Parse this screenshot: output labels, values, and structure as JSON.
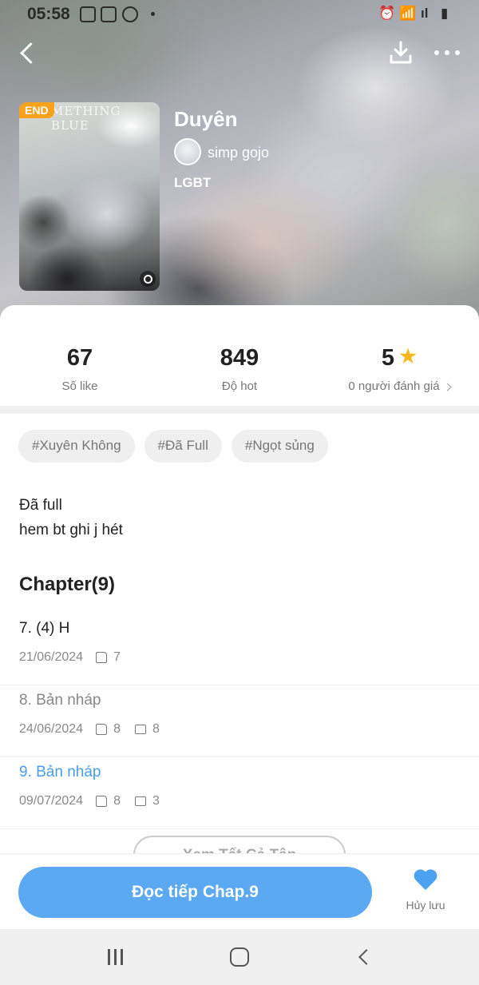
{
  "status_bar": {
    "time": "05:58",
    "left_icons": [
      "gallery-icon",
      "youtube-icon",
      "dnd-icon"
    ],
    "right_icons": [
      "alarm-icon",
      "wifi-icon",
      "signal-icon",
      "battery-icon"
    ]
  },
  "header": {
    "back_icon": "chevron-left-icon",
    "download_icon": "download-icon",
    "more_icon": "more-horizontal-icon"
  },
  "story": {
    "cover_text": "METHING BLUE",
    "badge": "END",
    "title": "Duyên",
    "author": "simp gojo",
    "genre": "LGBT"
  },
  "stats": [
    {
      "value": "67",
      "label": "Số like"
    },
    {
      "value": "849",
      "label": "Độ hot"
    },
    {
      "value": "5",
      "label": "0 người đánh giá"
    }
  ],
  "tags": [
    "#Xuyên Không",
    "#Đã Full",
    "#Ngọt sủng"
  ],
  "description": [
    "Đã full",
    "hem bt ghi j hét"
  ],
  "chapters": {
    "heading": "Chapter(9)",
    "items": [
      {
        "title": "7. (4) H",
        "date": "21/06/2024",
        "likes": "7",
        "comments": ""
      },
      {
        "title": "8. Bản nháp",
        "date": "24/06/2024",
        "likes": "8",
        "comments": "8"
      },
      {
        "title": "9. Bản nháp",
        "date": "09/07/2024",
        "likes": "8",
        "comments": "3"
      }
    ],
    "view_all": "Xem Tất Cả Tập"
  },
  "bottom": {
    "continue_label": "Đọc tiếp Chap.9",
    "favorite_label": "Hủy lưu"
  },
  "colors": {
    "accent": "#5ba8f3",
    "heart": "#4ca1f1",
    "badge": "#f7a21a",
    "star": "#f7b81e",
    "chapter_read": "#888888",
    "chapter_current": "#4a9de8"
  }
}
